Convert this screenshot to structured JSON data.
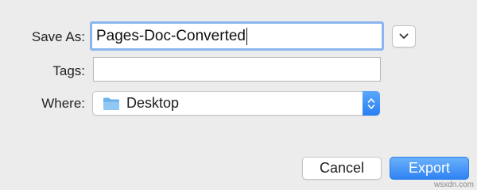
{
  "dialog": {
    "save_as_label": "Save As:",
    "save_as_value": "Pages-Doc-Converted",
    "tags_label": "Tags:",
    "tags_value": "",
    "where_label": "Where:",
    "where_value": "Desktop",
    "where_icon": "folder-icon",
    "expand_icon": "chevron-down-icon"
  },
  "buttons": {
    "cancel": "Cancel",
    "export": "Export"
  },
  "watermark": "wsxdn.com",
  "colors": {
    "background": "#ececec",
    "focus_ring": "#8ab6ee",
    "accent": "#2f82f3",
    "folder": "#6cb4f0"
  }
}
